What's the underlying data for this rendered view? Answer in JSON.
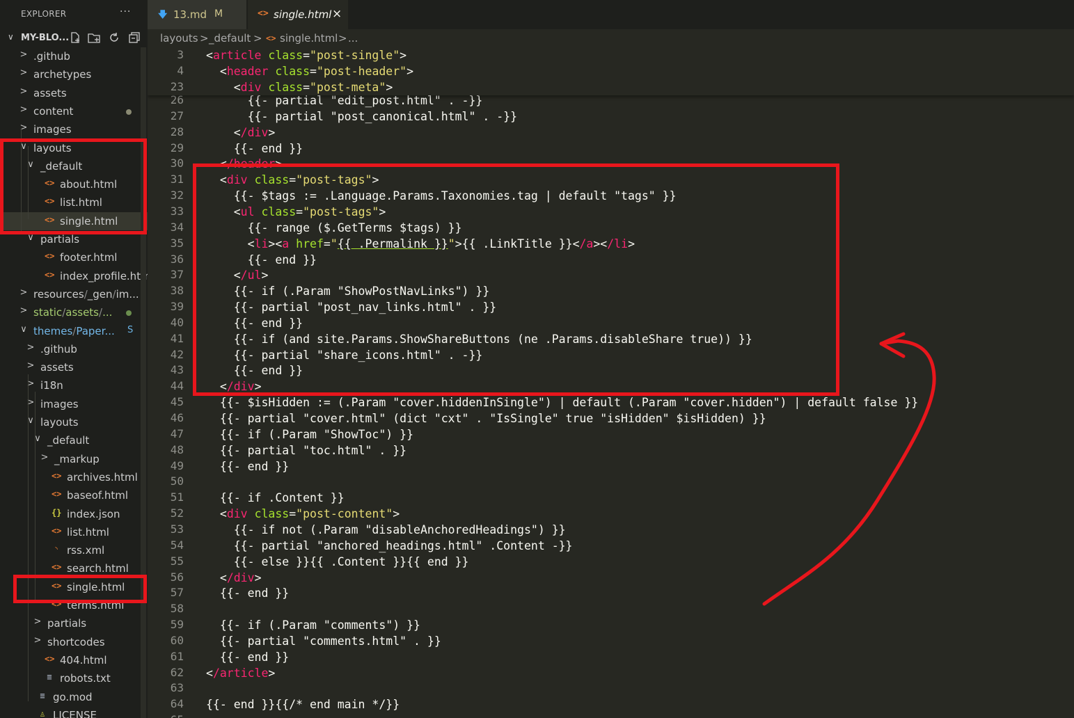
{
  "explorer": {
    "title": "EXPLORER",
    "more": "···"
  },
  "project": {
    "name": "MY-BLO...",
    "chevron": "∨"
  },
  "tree": [
    {
      "label": ".github",
      "chev": ">",
      "dot": false
    },
    {
      "label": "archetypes",
      "chev": ">"
    },
    {
      "label": "assets",
      "chev": ">"
    },
    {
      "label": "content",
      "chev": ">",
      "dot": "grey"
    },
    {
      "label": "images",
      "chev": ">"
    },
    {
      "label": "layouts",
      "chev": "∨"
    },
    {
      "label": "_default",
      "chev": "∨"
    },
    {
      "label": "about.html",
      "icon": "<>"
    },
    {
      "label": "list.html",
      "icon": "<>"
    },
    {
      "label": "single.html",
      "icon": "<>",
      "selected": true
    },
    {
      "label": "partials",
      "chev": "∨"
    },
    {
      "label": "footer.html",
      "icon": "<>"
    },
    {
      "label": "index_profile.html",
      "icon": "<>"
    },
    {
      "label": "resources",
      "chev": ">",
      "sep1": "/",
      "part2": "_gen",
      "sep2": "/",
      "part3": "im..."
    },
    {
      "label": "static",
      "chev": ">",
      "sep1": "/",
      "part2": "assets",
      "sep2": "/",
      "part3": "...",
      "dot": "green"
    },
    {
      "label": "themes",
      "chev": "∨",
      "sep1": "/",
      "part2": "Paper...",
      "badge": "S"
    },
    {
      "label": ".github",
      "chev": ">"
    },
    {
      "label": "assets",
      "chev": ">"
    },
    {
      "label": "i18n",
      "chev": ">"
    },
    {
      "label": "images",
      "chev": ">"
    },
    {
      "label": "layouts",
      "chev": "∨"
    },
    {
      "label": "_default",
      "chev": "∨"
    },
    {
      "label": "_markup",
      "chev": ">"
    },
    {
      "label": "archives.html",
      "icon": "<>"
    },
    {
      "label": "baseof.html",
      "icon": "<>"
    },
    {
      "label": "index.json",
      "icon": "{}"
    },
    {
      "label": "list.html",
      "icon": "<>"
    },
    {
      "label": "rss.xml",
      "icon": "rss"
    },
    {
      "label": "search.html",
      "icon": "<>"
    },
    {
      "label": "single.html",
      "icon": "<>"
    },
    {
      "label": "terms.html",
      "icon": "<>"
    },
    {
      "label": "partials",
      "chev": ">"
    },
    {
      "label": "shortcodes",
      "chev": ">"
    },
    {
      "label": "404.html",
      "icon": "<>"
    },
    {
      "label": "robots.txt",
      "icon": "≡"
    },
    {
      "label": "go.mod",
      "icon": "≡"
    },
    {
      "label": "LICENSE",
      "icon": "lic"
    }
  ],
  "tabs": [
    {
      "label": "13.md",
      "modified": "M",
      "icon": "down-arrow-icon"
    },
    {
      "label": "single.html",
      "close": "×",
      "icon": "html-icon",
      "active": true
    }
  ],
  "breadcrumb": {
    "p1": "layouts",
    "s1": ">",
    "p2": "_default",
    "s2": ">",
    "p3": "single.html",
    "s3": ">",
    "p4": "..."
  },
  "sticky_lines": [
    {
      "n": "3",
      "html": "<article class=\"post-single\">"
    },
    {
      "n": "4",
      "html": "  <header class=\"post-header\">"
    },
    {
      "n": "23",
      "html": "    <div class=\"post-meta\">"
    }
  ],
  "lines": [
    {
      "n": "26",
      "t": "      {{- partial \"edit_post.html\" . -}}"
    },
    {
      "n": "27",
      "t": "      {{- partial \"post_canonical.html\" . -}}"
    },
    {
      "n": "28",
      "t": "    </div>"
    },
    {
      "n": "29",
      "t": "    {{- end }}"
    },
    {
      "n": "30",
      "t": "  </header>"
    },
    {
      "n": "31",
      "t": "  <div class=\"post-tags\">"
    },
    {
      "n": "32",
      "t": "    {{- $tags := .Language.Params.Taxonomies.tag | default \"tags\" }}"
    },
    {
      "n": "33",
      "t": "    <ul class=\"post-tags\">"
    },
    {
      "n": "34",
      "t": "      {{- range ($.GetTerms $tags) }}"
    },
    {
      "n": "35",
      "t": "      <li><a href=\"{{ .Permalink }}\">{{ .LinkTitle }}</a></li>"
    },
    {
      "n": "36",
      "t": "      {{- end }}"
    },
    {
      "n": "37",
      "t": "    </ul>"
    },
    {
      "n": "38",
      "t": "    {{- if (.Param \"ShowPostNavLinks\") }}"
    },
    {
      "n": "39",
      "t": "    {{- partial \"post_nav_links.html\" . }}"
    },
    {
      "n": "40",
      "t": "    {{- end }}"
    },
    {
      "n": "41",
      "t": "    {{- if (and site.Params.ShowShareButtons (ne .Params.disableShare true)) }}"
    },
    {
      "n": "42",
      "t": "    {{- partial \"share_icons.html\" . -}}"
    },
    {
      "n": "43",
      "t": "    {{- end }}"
    },
    {
      "n": "44",
      "t": "  </div>"
    },
    {
      "n": "45",
      "t": "  {{- $isHidden := (.Param \"cover.hiddenInSingle\") | default (.Param \"cover.hidden\") | default false }}"
    },
    {
      "n": "46",
      "t": "  {{- partial \"cover.html\" (dict \"cxt\" . \"IsSingle\" true \"isHidden\" $isHidden) }}"
    },
    {
      "n": "47",
      "t": "  {{- if (.Param \"ShowToc\") }}"
    },
    {
      "n": "48",
      "t": "  {{- partial \"toc.html\" . }}"
    },
    {
      "n": "49",
      "t": "  {{- end }}"
    },
    {
      "n": "50",
      "t": ""
    },
    {
      "n": "51",
      "t": "  {{- if .Content }}"
    },
    {
      "n": "52",
      "t": "  <div class=\"post-content\">"
    },
    {
      "n": "53",
      "t": "    {{- if not (.Param \"disableAnchoredHeadings\") }}"
    },
    {
      "n": "54",
      "t": "    {{- partial \"anchored_headings.html\" .Content -}}"
    },
    {
      "n": "55",
      "t": "    {{- else }}{{ .Content }}{{ end }}"
    },
    {
      "n": "56",
      "t": "  </div>"
    },
    {
      "n": "57",
      "t": "  {{- end }}"
    },
    {
      "n": "58",
      "t": ""
    },
    {
      "n": "59",
      "t": "  {{- if (.Param \"comments\") }}"
    },
    {
      "n": "60",
      "t": "  {{- partial \"comments.html\" . }}"
    },
    {
      "n": "61",
      "t": "  {{- end }}"
    },
    {
      "n": "62",
      "t": "</article>"
    },
    {
      "n": "63",
      "t": ""
    },
    {
      "n": "64",
      "t": "{{- end }}{{/* end main */}}"
    },
    {
      "n": "65",
      "t": ""
    }
  ],
  "colors": {
    "tag": "#f92672",
    "attr": "#a6e22e",
    "string": "#e6db74",
    "annotation": "#e8161c"
  }
}
